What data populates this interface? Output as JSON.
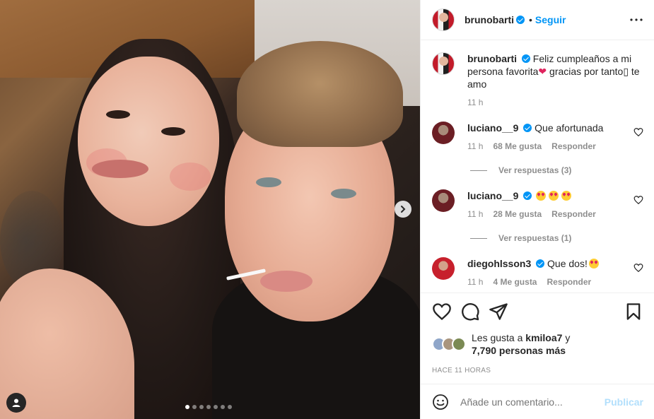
{
  "post": {
    "author": "brunobarti",
    "follow_label": "Seguir",
    "caption": "Feliz cumpleaños a mi persona favorita",
    "caption_rest": "gracias por tanto▯ te amo",
    "caption_time": "11 h",
    "carousel": {
      "current_slide": 1,
      "total_slides": 7
    }
  },
  "comments": [
    {
      "user": "luciano__9",
      "text": "Que afortunada",
      "time": "11 h",
      "likes": "68 Me gusta",
      "reply": "Responder",
      "view_replies": "Ver respuestas (3)"
    },
    {
      "user": "luciano__9",
      "text": "",
      "time": "11 h",
      "likes": "28 Me gusta",
      "reply": "Responder",
      "view_replies": "Ver respuestas (1)"
    },
    {
      "user": "diegohlsson3",
      "text": "Que dos!",
      "time": "11 h",
      "likes": "4 Me gusta",
      "reply": "Responder"
    }
  ],
  "likes": {
    "prefix": "Les gusta a",
    "user": "kmiloa7",
    "conj": "y",
    "count": "7,790 personas más"
  },
  "timestamp": "HACE 11 HORAS",
  "add_comment": {
    "placeholder": "Añade un comentario...",
    "post_label": "Publicar"
  },
  "icons": {
    "more": "more-horizontal-icon",
    "like": "heart-icon",
    "comment": "comment-icon",
    "share": "send-icon",
    "save": "bookmark-icon",
    "emoji": "smile-icon",
    "next": "chevron-right-icon",
    "tag": "user-tag-icon"
  },
  "colors": {
    "link": "#0095f6",
    "verified": "#0095f6",
    "muted": "#8e8e8e",
    "text": "#262626",
    "post_disabled": "#b2dffc"
  }
}
